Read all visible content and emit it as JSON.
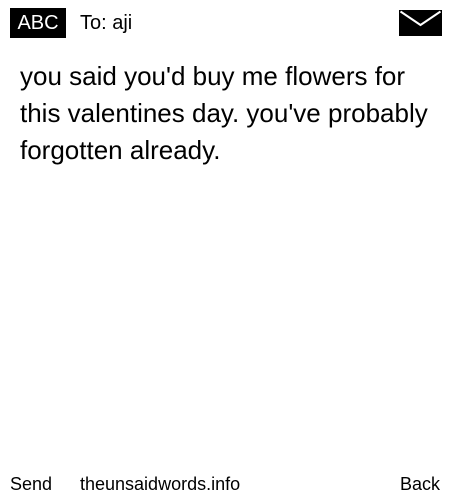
{
  "header": {
    "mode_label": "ABC",
    "recipient_label": "To: aji",
    "mail_icon": "envelope-icon"
  },
  "message": {
    "body": "you said you'd buy me flowers for this valentines day. you've probably forgotten already."
  },
  "footer": {
    "send_label": "Send",
    "site_label": "theunsaidwords.info",
    "back_label": "Back"
  },
  "colors": {
    "background": "#ffffff",
    "text": "#000000",
    "badge_bg": "#000000",
    "badge_text": "#ffffff"
  }
}
